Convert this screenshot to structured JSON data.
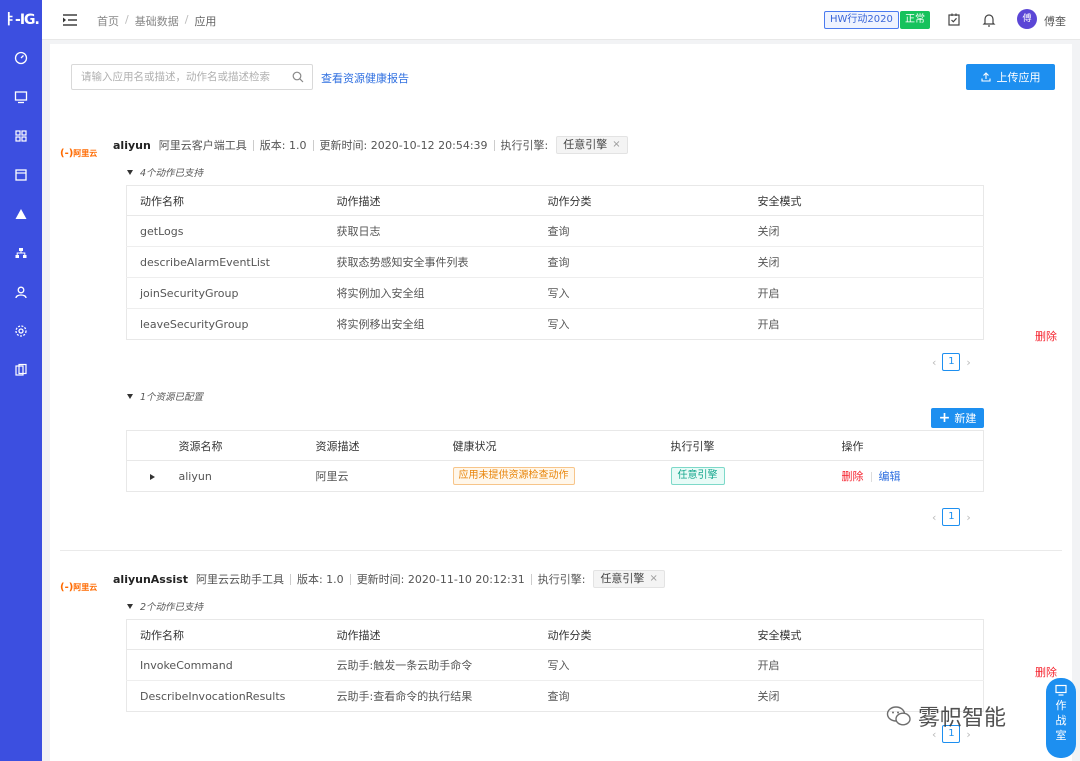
{
  "app": {
    "logo": "ㅑ-IG."
  },
  "header": {
    "breadcrumb": [
      "首页",
      "基础数据",
      "应用"
    ],
    "hw_tag": "HW行动2020",
    "status_tag": "正常",
    "username": "傅奎",
    "avatar_text": "傅"
  },
  "toolbar": {
    "search_placeholder": "请输入应用名或描述，动作名或描述检索",
    "report_link": "查看资源健康报告",
    "upload_label": "上传应用"
  },
  "common": {
    "delete_label": "删除",
    "new_label": "新建",
    "vendor_logo": "阿里云",
    "page_number": "1",
    "prev": "‹",
    "next": "›",
    "tag_close": "×"
  },
  "action_columns": [
    "动作名称",
    "动作描述",
    "动作分类",
    "安全模式"
  ],
  "resource_columns": [
    "资源名称",
    "资源描述",
    "健康状况",
    "执行引擎",
    "操作"
  ],
  "apps": [
    {
      "name": "aliyun",
      "desc": "阿里云客户端工具",
      "version": "版本: 1.0",
      "updated": "更新时间: 2020-10-12 20:54:39",
      "engine_label": "执行引擎:",
      "engine": "任意引擎",
      "actions_summary": "4个动作已支持",
      "actions": [
        [
          "getLogs",
          "获取日志",
          "查询",
          "关闭"
        ],
        [
          "describeAlarmEventList",
          "获取态势感知安全事件列表",
          "查询",
          "关闭"
        ],
        [
          "joinSecurityGroup",
          "将实例加入安全组",
          "写入",
          "开启"
        ],
        [
          "leaveSecurityGroup",
          "将实例移出安全组",
          "写入",
          "开启"
        ]
      ],
      "resources_summary": "1个资源已配置",
      "resources": [
        {
          "name": "aliyun",
          "desc": "阿里云",
          "health": "应用未提供资源检查动作",
          "engine": "任意引擎",
          "op_delete": "删除",
          "op_edit": "编辑"
        }
      ]
    },
    {
      "name": "aliyunAssist",
      "desc": "阿里云云助手工具",
      "version": "版本: 1.0",
      "updated": "更新时间: 2020-11-10 20:12:31",
      "engine_label": "执行引擎:",
      "engine": "任意引擎",
      "actions_summary": "2个动作已支持",
      "actions": [
        [
          "InvokeCommand",
          "云助手:触发一条云助手命令",
          "写入",
          "开启"
        ],
        [
          "DescribeInvocationResults",
          "云助手:查看命令的执行结果",
          "查询",
          "关闭"
        ]
      ]
    }
  ],
  "floating": {
    "war_room": [
      "作",
      "战",
      "室"
    ]
  },
  "watermark": "雾帜智能"
}
